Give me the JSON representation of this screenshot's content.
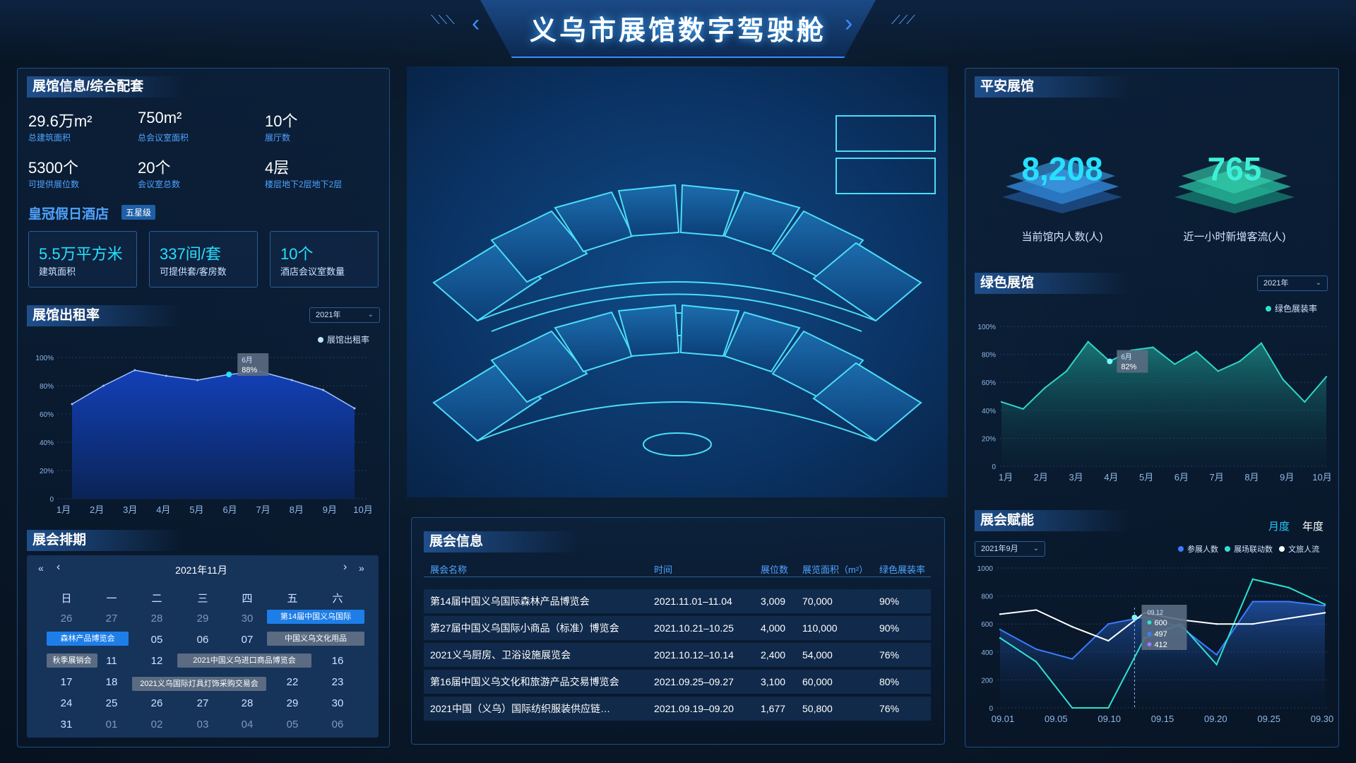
{
  "header": {
    "title": "义乌市展馆数字驾驶舱"
  },
  "venue": {
    "title": "展馆信息/综合配套",
    "stats": [
      {
        "value": "29.6万m²",
        "label": "总建筑面积"
      },
      {
        "value": "750m²",
        "label": "总会议室面积"
      },
      {
        "value": "10个",
        "label": "展厅数"
      },
      {
        "value": "5300个",
        "label": "可提供展位数"
      },
      {
        "value": "20个",
        "label": "会议室总数"
      },
      {
        "value": "4层",
        "label": "楼层地下2层地下2层"
      }
    ],
    "hotel": {
      "name": "皇冠假日酒店",
      "badge": "五星级",
      "items": [
        {
          "value": "5.5万平方米",
          "label": "建筑面积"
        },
        {
          "value": "337间/套",
          "label": "可提供套/客房数"
        },
        {
          "value": "10个",
          "label": "酒店会议室数量"
        }
      ]
    }
  },
  "rental": {
    "title": "展馆出租率",
    "year_select": "2021年",
    "legend": "展馆出租率",
    "tooltip": {
      "month": "6月",
      "value": "88%"
    }
  },
  "schedule": {
    "title": "展会排期",
    "month": "2021年11月",
    "nav": {
      "prev_year": "«",
      "prev": "‹",
      "next": "›",
      "next_year": "»"
    },
    "weekdays": [
      "日",
      "一",
      "二",
      "三",
      "四",
      "五",
      "六"
    ],
    "rows": [
      [
        "26",
        "27",
        "28",
        "29",
        "30",
        "",
        ""
      ],
      [
        "",
        "",
        "05",
        "06",
        "07",
        "",
        ""
      ],
      [
        "",
        "11",
        "12",
        "",
        "",
        "",
        "16"
      ],
      [
        "17",
        "18",
        "",
        "",
        "",
        "22",
        "23"
      ],
      [
        "24",
        "25",
        "26",
        "27",
        "28",
        "29",
        "30"
      ],
      [
        "31",
        "01",
        "02",
        "03",
        "04",
        "05",
        "06"
      ]
    ],
    "events": [
      {
        "label": "第14届中国义乌国际",
        "style": "blue"
      },
      {
        "label": "森林产品博览会",
        "style": "blue"
      },
      {
        "label": "中国义乌文化用品",
        "style": "gray"
      },
      {
        "label": "秋季展销会",
        "style": "gray"
      },
      {
        "label": "2021中国义乌进口商品博览会",
        "style": "gray"
      },
      {
        "label": "2021义乌国际灯具灯饰采购交易会",
        "style": "gray"
      }
    ]
  },
  "exhibitions": {
    "title": "展会信息",
    "columns": [
      "展会名称",
      "时间",
      "展位数",
      "展览面积（m²）",
      "绿色展装率"
    ],
    "rows": [
      [
        "第14届中国义乌国际森林产品博览会",
        "2021.11.01–11.04",
        "3,009",
        "70,000",
        "90%"
      ],
      [
        "第27届中国义乌国际小商品（标准）博览会",
        "2021.10.21–10.25",
        "4,000",
        "110,000",
        "90%"
      ],
      [
        "2021义乌厨房、卫浴设施展览会",
        "2021.10.12–10.14",
        "2,400",
        "54,000",
        "76%"
      ],
      [
        "第16届中国义乌文化和旅游产品交易博览会",
        "2021.09.25–09.27",
        "3,100",
        "60,000",
        "80%"
      ],
      [
        "2021中国（义乌）国际纺织服装供应链…",
        "2021.09.19–09.20",
        "1,677",
        "50,800",
        "76%"
      ]
    ]
  },
  "safety": {
    "title": "平安展馆",
    "current_visitors": {
      "value": "8,208",
      "label": "当前馆内人数(人)"
    },
    "new_visitors": {
      "value": "765",
      "label": "近一小时新增客流(人)"
    }
  },
  "green": {
    "title": "绿色展馆",
    "year_select": "2021年",
    "legend": "绿色展装率",
    "tooltip": {
      "month": "6月",
      "value": "82%"
    }
  },
  "empower": {
    "title": "展会赋能",
    "tabs": [
      "月度",
      "年度"
    ],
    "month_select": "2021年9月",
    "tooltip": {
      "date": "09.12",
      "v1": "600",
      "v2": "497",
      "v3": "412"
    }
  },
  "colors": {
    "accent": "#27e0ff",
    "panel_border": "#1e4f86",
    "rental_fill": "#1340b8",
    "green_line": "#2fd6c8",
    "series_blue": "#3b7bff",
    "series_teal": "#2fe0d0",
    "series_white": "#ffffff"
  },
  "chart_data": [
    {
      "type": "area",
      "categories": [
        "1月",
        "2月",
        "3月",
        "4月",
        "5月",
        "6月",
        "7月",
        "8月",
        "9月",
        "10月"
      ],
      "series": [
        {
          "name": "展馆出租率",
          "values": [
            67,
            80,
            91,
            87,
            84,
            88,
            90,
            84,
            77,
            64
          ]
        }
      ],
      "ylim": [
        0,
        100
      ],
      "yticks": [
        "0",
        "20%",
        "40%",
        "60%",
        "80%",
        "100%"
      ]
    },
    {
      "type": "line",
      "categories": [
        "1月",
        "2月",
        "3月",
        "4月",
        "5月",
        "6月",
        "7月",
        "8月",
        "9月",
        "10月"
      ],
      "series": [
        {
          "name": "绿色展装率",
          "values": [
            46,
            41,
            56,
            68,
            89,
            75,
            83,
            85,
            73,
            82,
            68,
            75,
            88,
            62,
            46,
            64
          ]
        }
      ],
      "x_points": 16,
      "ylim": [
        0,
        100
      ],
      "yticks": [
        "0",
        "20%",
        "40%",
        "60%",
        "80%",
        "100%"
      ]
    },
    {
      "type": "line",
      "categories": [
        "09.01",
        "09.05",
        "09.10",
        "09.15",
        "09.20",
        "09.25",
        "09.30"
      ],
      "series": [
        {
          "name": "参展人数",
          "values": [
            560,
            420,
            350,
            600,
            650,
            580,
            380,
            760,
            760,
            730
          ]
        },
        {
          "name": "展场联动数",
          "values": [
            500,
            330,
            0,
            0,
            497,
            600,
            310,
            920,
            860,
            740
          ]
        },
        {
          "name": "文旅人流",
          "values": [
            670,
            700,
            580,
            480,
            680,
            630,
            600,
            600,
            640,
            680
          ]
        }
      ],
      "ylim": [
        0,
        1000
      ],
      "yticks": [
        "0",
        "200",
        "400",
        "600",
        "800",
        "1000"
      ]
    }
  ]
}
